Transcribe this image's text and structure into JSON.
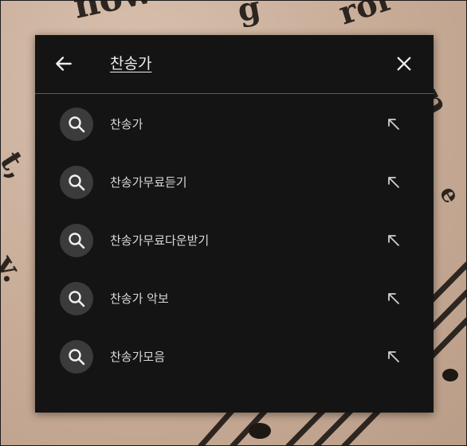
{
  "search": {
    "query": "찬송가"
  },
  "suggestions": [
    {
      "label": "찬송가"
    },
    {
      "label": "찬송가무료듣기"
    },
    {
      "label": "찬송가무료다운받기"
    },
    {
      "label": "찬송가 악보"
    },
    {
      "label": "찬송가모음"
    }
  ],
  "icons": {
    "back": "arrow-left-icon",
    "clear": "close-icon",
    "suggestion": "search-icon",
    "fill": "arrow-up-left-icon"
  },
  "colors": {
    "panel": "#141414",
    "text": "#eeeeee",
    "icon_circle": "#3b3b3b",
    "divider": "#5a5a5a"
  }
}
